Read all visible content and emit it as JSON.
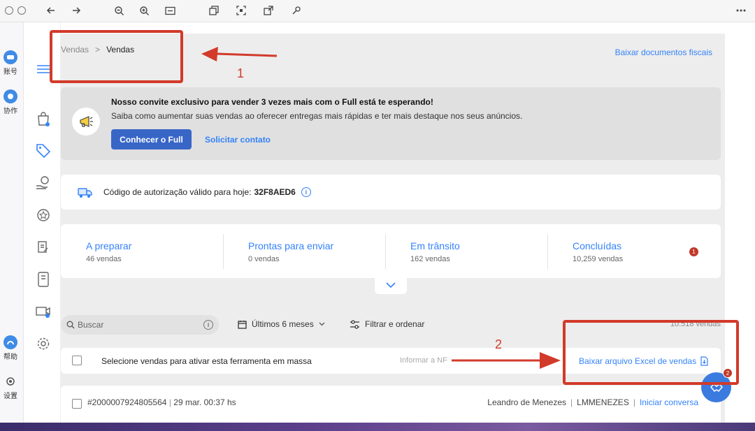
{
  "breadcrumb": {
    "parent": "Vendas",
    "separator": ">",
    "current": "Vendas"
  },
  "fiscal_link": "Baixar documentos fiscais",
  "app_sidebar": [
    {
      "label": "账号",
      "icon": "account-icon"
    },
    {
      "label": "协作",
      "icon": "collaboration-icon"
    },
    {
      "label": "帮助",
      "icon": "help-icon"
    },
    {
      "label": "设置",
      "icon": "settings-icon"
    }
  ],
  "promo": {
    "title": "Nosso convite exclusivo para vender 3 vezes mais com o Full está te esperando!",
    "description": "Saiba como aumentar suas vendas ao oferecer entregas mais rápidas e ter mais destaque nos seus anúncios.",
    "primary_button": "Conhecer o Full",
    "secondary_link": "Solicitar contato"
  },
  "authorization": {
    "label": "Código de autorização válido para hoje:",
    "code": "32F8AED6"
  },
  "stats": [
    {
      "title": "A preparar",
      "sub": "46 vendas"
    },
    {
      "title": "Prontas para enviar",
      "sub": "0 vendas"
    },
    {
      "title": "Em trânsito",
      "sub": "162 vendas"
    },
    {
      "title": "Concluídas",
      "sub": "10,259 vendas",
      "badge": "1"
    }
  ],
  "filters": {
    "search_placeholder": "Buscar",
    "period": "Últimos 6 meses",
    "filter_label": "Filtrar e ordenar",
    "count": "10.518 vendas"
  },
  "bulk": {
    "text": "Selecione vendas para ativar esta ferramenta em massa",
    "nf_label": "Informar a NF",
    "excel_link": "Baixar arquivo Excel de vendas"
  },
  "order": {
    "id": "#2000007924805564",
    "date": "29 mar. 00:37 hs",
    "buyer": "Leandro de Menezes",
    "nickname": "LMMENEZES",
    "action": "Iniciar conversa"
  },
  "fab_badge": "2",
  "annotations": {
    "num1": "1",
    "num2": "2"
  },
  "colors": {
    "accent": "#3483fa",
    "primary_button": "#3866c7",
    "annotation": "#d23a2a"
  }
}
